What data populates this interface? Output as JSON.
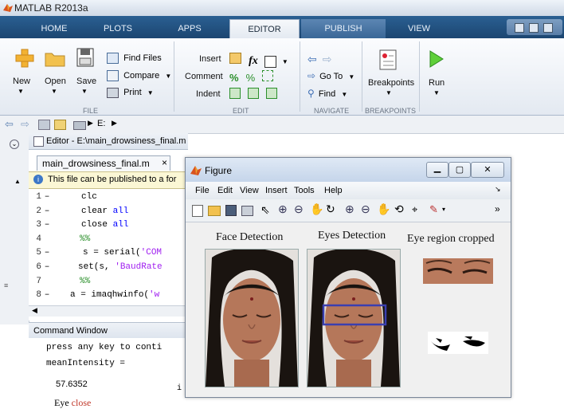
{
  "app": {
    "title": "MATLAB R2013a"
  },
  "tabs": [
    "HOME",
    "PLOTS",
    "APPS",
    "EDITOR",
    "PUBLISH",
    "VIEW"
  ],
  "ribbon": {
    "file": {
      "new": "New",
      "open": "Open",
      "save": "Save",
      "find_files": "Find Files",
      "compare": "Compare",
      "print": "Print",
      "group": "FILE"
    },
    "edit": {
      "insert": "Insert",
      "comment": "Comment",
      "indent": "Indent",
      "group": "EDIT"
    },
    "navigate": {
      "goto": "Go To",
      "find": "Find",
      "group": "NAVIGATE"
    },
    "breakpoints": {
      "label": "Breakpoints",
      "group": "BREAKPOINTS"
    },
    "run": {
      "label": "Run"
    }
  },
  "address": {
    "path": "E:"
  },
  "editor": {
    "title": "Editor - E:\\main_drowsiness_final.m",
    "file_tab": "main_drowsiness_final.m",
    "close_tab": "×",
    "info": "This file can be published to a for",
    "lines": [
      {
        "n": "1",
        "dash": "–",
        "code": "clc"
      },
      {
        "n": "2",
        "dash": "–",
        "code": "clear all"
      },
      {
        "n": "3",
        "dash": "–",
        "code": "close all"
      },
      {
        "n": "4",
        "dash": "",
        "code": "%%"
      },
      {
        "n": "5",
        "dash": "–",
        "code": "s = serial('COM"
      },
      {
        "n": "6",
        "dash": "–",
        "code": "set(s, 'BaudRate"
      },
      {
        "n": "7",
        "dash": "",
        "code": "%%"
      },
      {
        "n": "8",
        "dash": "–",
        "code": "a = imaqhwinfo('w"
      }
    ]
  },
  "command": {
    "title": "Command Window",
    "lines": [
      "press any key to conti",
      "meanIntensity =",
      "57.6352"
    ],
    "fx_fragment": "i"
  },
  "below": {
    "word1": "Eye",
    "word2": "close"
  },
  "figure": {
    "title": "Figure",
    "menu": [
      "File",
      "Edit",
      "View",
      "Insert",
      "Tools",
      "Help"
    ],
    "captions": [
      "Face Detection",
      "Eyes Detection",
      "Eye region cropped"
    ],
    "more": "»"
  },
  "colors": {
    "tab_bar": "#1c4671",
    "accent": "#0000ff",
    "string": "#a020f0",
    "comment": "#228b22",
    "eye_box": "#3a3fb0",
    "close_text": "#c0392b"
  }
}
